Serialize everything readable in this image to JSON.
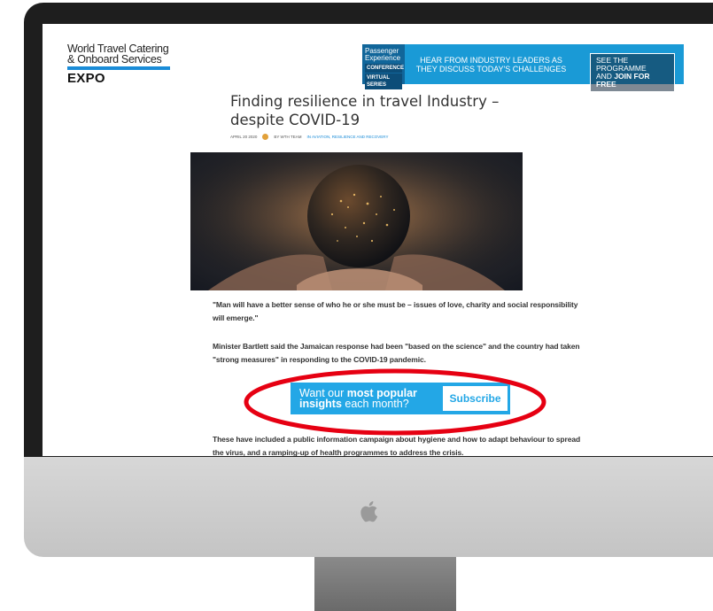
{
  "site": {
    "logo_line1": "World Travel Catering",
    "logo_line2": "& Onboard Services",
    "logo_expo": "EXPO"
  },
  "banner": {
    "brand_line1": "Passenger",
    "brand_line2": "Experience",
    "brand_tag1": "CONFERENCE",
    "brand_tag2": "VIRTUAL SERIES",
    "headline": "HEAR FROM INDUSTRY LEADERS AS THEY DISCUSS TODAY'S CHALLENGES",
    "cta_line1": "SEE THE PROGRAMME",
    "cta_line2_a": "AND ",
    "cta_line2_b": "JOIN FOR FREE"
  },
  "article": {
    "title": "Finding resilience in travel Industry – despite COVID-19",
    "date": "APRIL 20 2020",
    "author": "BY WTH TEAM",
    "categories": "IN AVIATION, RESILIENCE AND RECOVERY",
    "para1": "\"Man will have a better sense of who he or she must be – issues of love, charity and social responsibility will emerge.\"",
    "para2": "Minister Bartlett said the Jamaican response had been \"based on the science\" and the country had taken \"strong measures\" in responding to the COVID-19 pandemic.",
    "para3": "These have included a public information campaign about hygiene and how to adapt behaviour to spread the virus, and a ramping-up of health programmes to address the crisis."
  },
  "subscribe": {
    "text_a": "Want our ",
    "text_b": "most popular insights",
    "text_c": " each month?",
    "button_label": "Subscribe"
  },
  "colors": {
    "accent_blue": "#23a7e6",
    "highlight_red": "#e60012"
  }
}
